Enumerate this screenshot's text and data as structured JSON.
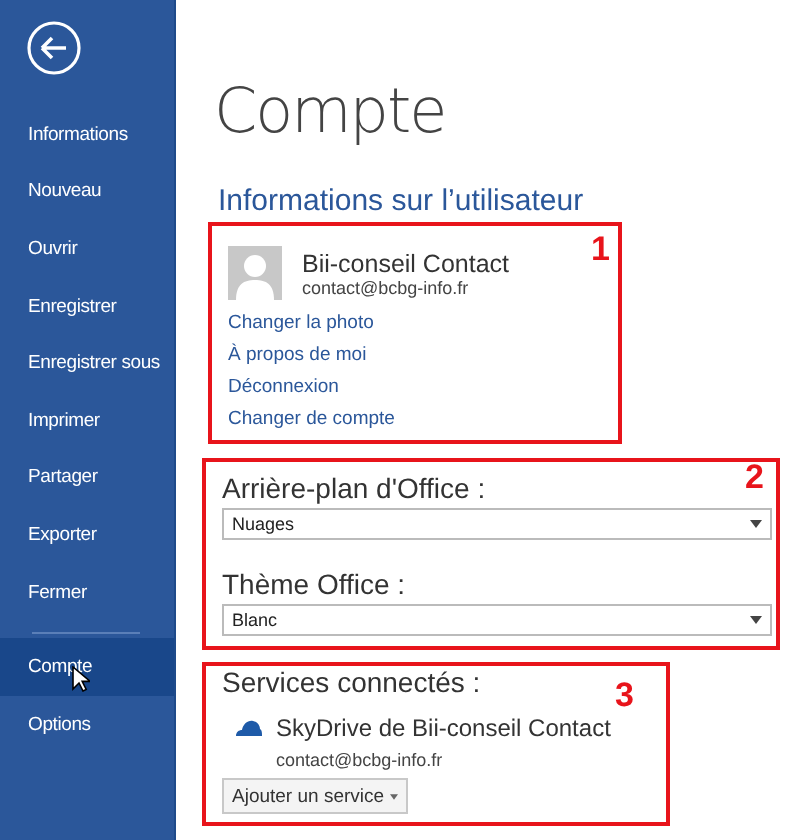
{
  "sidebar": {
    "items": [
      {
        "label": "Informations",
        "selected": false
      },
      {
        "label": "Nouveau",
        "selected": false
      },
      {
        "label": "Ouvrir",
        "selected": false
      },
      {
        "label": "Enregistrer",
        "selected": false
      },
      {
        "label": "Enregistrer sous",
        "selected": false
      },
      {
        "label": "Imprimer",
        "selected": false
      },
      {
        "label": "Partager",
        "selected": false
      },
      {
        "label": "Exporter",
        "selected": false
      },
      {
        "label": "Fermer",
        "selected": false
      },
      {
        "label": "Compte",
        "selected": true
      },
      {
        "label": "Options",
        "selected": false
      }
    ]
  },
  "page_title": "Compte",
  "user_info": {
    "heading": "Informations sur l’utilisateur",
    "callout": "1",
    "name": "Bii-conseil Contact",
    "email": "contact@bcbg-info.fr",
    "links": [
      "Changer la photo",
      "À propos de moi",
      "Déconnexion",
      "Changer de compte"
    ]
  },
  "appearance": {
    "callout": "2",
    "background_label": "Arrière-plan d'Office :",
    "background_value": "Nuages",
    "theme_label": "Thème Office :",
    "theme_value": "Blanc"
  },
  "services": {
    "callout": "3",
    "heading": "Services connectés :",
    "service_name": "SkyDrive de Bii-conseil Contact",
    "service_email": "contact@bcbg-info.fr",
    "add_button": "Ajouter un service"
  }
}
